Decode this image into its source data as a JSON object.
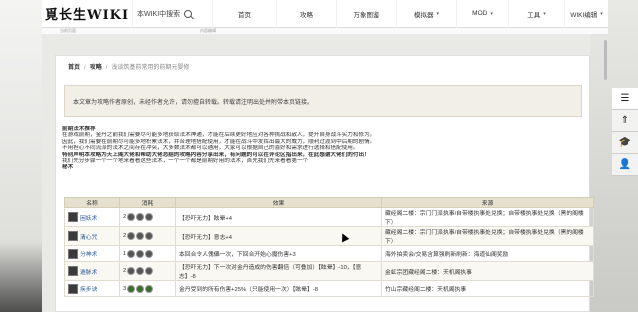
{
  "site": {
    "logo": "覓长生WIKI"
  },
  "search": {
    "placeholder": "本WIKI中搜索"
  },
  "nav": [
    {
      "label": "首页",
      "caret": ""
    },
    {
      "label": "攻略",
      "caret": ""
    },
    {
      "label": "万象图鉴",
      "caret": ""
    },
    {
      "label": "模拟器",
      "caret": "▾"
    },
    {
      "label": "MOD",
      "caret": "▾"
    },
    {
      "label": "工具",
      "caret": "▾"
    },
    {
      "label": "WIKI编辑",
      "caret": "▾"
    }
  ],
  "sub_strip": {
    "left": "当前页面",
    "right": "内容编辑"
  },
  "breadcrumb": {
    "home": "首页",
    "section": "攻略",
    "current": "浅谈筑基前常用的前期元婴修"
  },
  "notice": "本文章为攻略作者原创，未经作者允许，请勿擅自转载。转载请注明出处并附带本页链接。",
  "article": {
    "heading": "前期法术推荐",
    "lines": [
      "在游戏前期，金丹之前我们需要尽可能多地获取法术神通，才能在后续更好地应对各种挑战和敌人，提升自身战斗实力和修为。",
      "因此，我们需要在前期尽可能多地积累法术，并合理地搭配使用，才能在战斗中发挥出最大的威力，顺利过渡到中后期的剧情。",
      "不用担心不同流派的法术之间存在冲突，大多数法术都可以通用，大家可以根据自己的喜好和需求进行选择和搭配使用。",
      "特别声明本攻略为天上阁大佬和帮助大佬总结的攻略内容分享出来，有问题的可以在评论区指出来，在此感谢大佬们的付出！",
      "我们先分步骤一个一个地来看看这些法术，一个一个都是前期好用的法术，首先我们先来看看第一个"
    ],
    "sub_heading": "秘术"
  },
  "table": {
    "headers": [
      "名称",
      "消耗",
      "效果",
      "来源"
    ],
    "rows": [
      {
        "name": "困妖术",
        "cost": "2",
        "effect": "【恐吓无力】眩晕+4",
        "source": "藏经阁二楼：宗门门派执事/自带楼执事处兑换；自带楼执事处兑换（黑的阁楼下）"
      },
      {
        "name": "清心咒",
        "cost": "2",
        "effect": "【恐吓无力】意志+4",
        "source": "藏经阁二楼：宗门门派执事/自带楼执事处兑换；自带楼执事处兑换（黑的阁楼下）"
      },
      {
        "name": "分神术",
        "cost": "1",
        "effect": "本回合令人傀儡一次，下回合开始心魔伤害+3",
        "source": "海外拍卖会/交易含算强刷新刷新：海道仙阁奖励"
      },
      {
        "name": "遁脉术",
        "cost": "2",
        "effect": "【恐吓无力】下一次对金丹造成的伤害翻倍（可叠加）【眩晕】-10，【意志】-8",
        "source": "金虹宗团藏经阁二楼：天机阁执事"
      },
      {
        "name": "疾步诀",
        "cost": "3",
        "effect": "金丹受到的所有伤害+25%（只能使用一次）【眩晕】-8",
        "source": "竹山宗藏经阁二楼：天机阁执事"
      }
    ]
  },
  "float_buttons": [
    {
      "icon": "menu-icon",
      "glyph": "☰"
    },
    {
      "icon": "up-arrow-icon",
      "glyph": "⇑"
    },
    {
      "icon": "graduation-cap-icon",
      "glyph": "🎓"
    },
    {
      "icon": "user-icon",
      "glyph": "👤"
    }
  ],
  "colors": {
    "table_header": "#e6e0ce",
    "notice_bg": "#f2efe6",
    "link": "#2b5a9b"
  }
}
